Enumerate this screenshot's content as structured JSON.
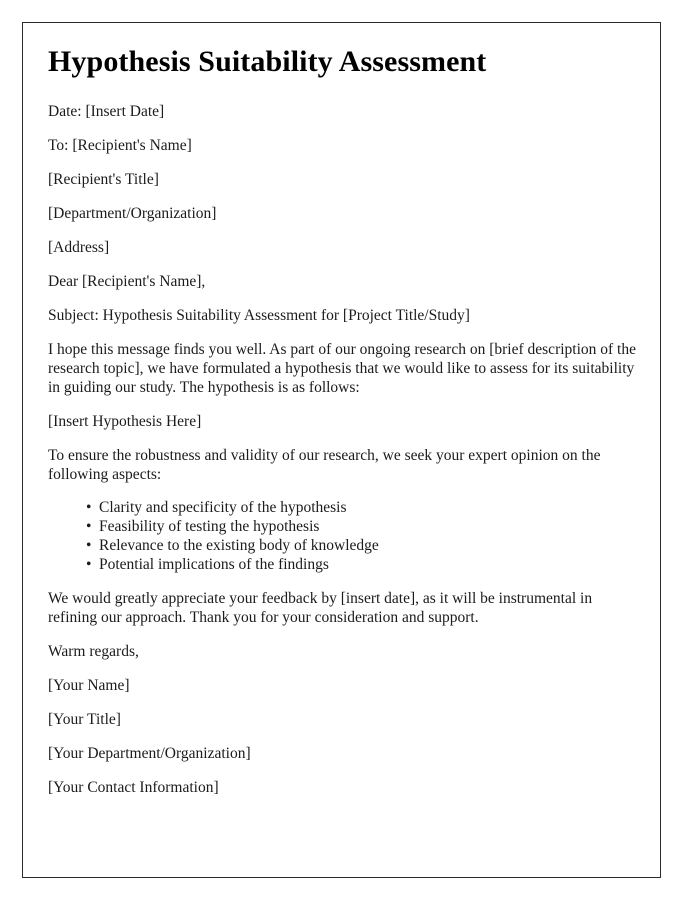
{
  "document": {
    "title": "Hypothesis Suitability Assessment",
    "header_lines": [
      "Date: [Insert Date]",
      "To: [Recipient's Name]",
      "[Recipient's Title]",
      "[Department/Organization]",
      "[Address]"
    ],
    "salutation": "Dear [Recipient's Name],",
    "subject": "Subject: Hypothesis Suitability Assessment for [Project Title/Study]",
    "intro_paragraph": "I hope this message finds you well. As part of our ongoing research on [brief description of the research topic], we have formulated a hypothesis that we would like to assess for its suitability in guiding our study. The hypothesis is as follows:",
    "hypothesis_placeholder": "[Insert Hypothesis Here]",
    "aspects_intro": "To ensure the robustness and validity of our research, we seek your expert opinion on the following aspects:",
    "aspects": [
      "Clarity and specificity of the hypothesis",
      "Feasibility of testing the hypothesis",
      "Relevance to the existing body of knowledge",
      "Potential implications of the findings"
    ],
    "bullet_glyph": "•",
    "closing_paragraph": "We would greatly appreciate your feedback by [insert date], as it will be instrumental in refining our approach. Thank you for your consideration and support.",
    "sign_off": "Warm regards,",
    "signature_lines": [
      "[Your Name]",
      "[Your Title]",
      "[Your Department/Organization]",
      "[Your Contact Information]"
    ],
    "colors": {
      "text": "#1b1b1b",
      "title": "#000000",
      "border": "#2b2b2e",
      "background": "#ffffff"
    }
  }
}
